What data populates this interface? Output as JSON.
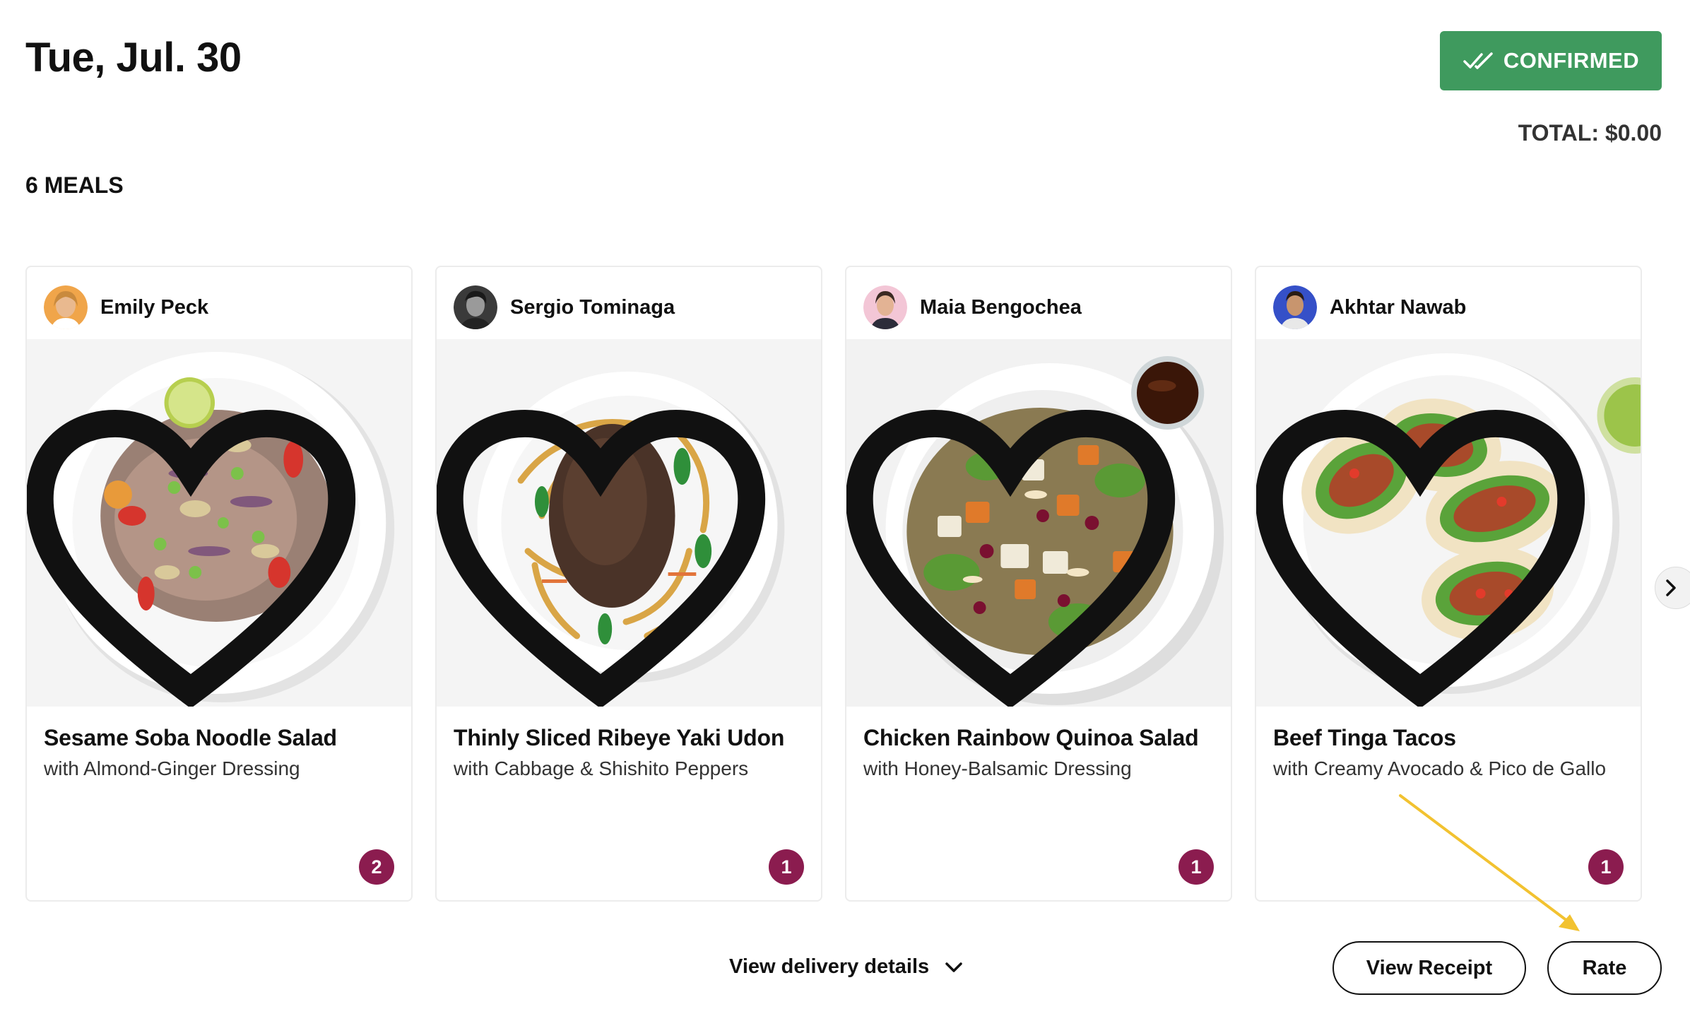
{
  "header": {
    "date": "Tue, Jul. 30",
    "status": "CONFIRMED",
    "total": "TOTAL: $0.00",
    "meal_count": "6 MEALS"
  },
  "meals": [
    {
      "chef": "Emily Peck",
      "title": "Sesame Soba Noodle Salad",
      "subtitle": "with Almond-Ginger Dressing",
      "quantity": "2"
    },
    {
      "chef": "Sergio Tominaga",
      "title": "Thinly Sliced Ribeye Yaki Udon",
      "subtitle": "with Cabbage & Shishito Peppers",
      "quantity": "1"
    },
    {
      "chef": "Maia Bengochea",
      "title": "Chicken Rainbow Quinoa Salad",
      "subtitle": "with Honey-Balsamic Dressing",
      "quantity": "1"
    },
    {
      "chef": "Akhtar Nawab",
      "title": "Beef Tinga Tacos",
      "subtitle": "with Creamy Avocado & Pico de Gallo",
      "quantity": "1"
    }
  ],
  "footer": {
    "delivery_details": "View delivery details",
    "view_receipt": "View Receipt",
    "rate": "Rate"
  },
  "colors": {
    "confirmed_green": "#3f9a5e",
    "quantity_badge": "#8b1c4f",
    "annotation_arrow": "#f2c230"
  },
  "icons": [
    "double-check-icon",
    "heart-icon",
    "chevron-right-icon",
    "chevron-down-icon"
  ]
}
